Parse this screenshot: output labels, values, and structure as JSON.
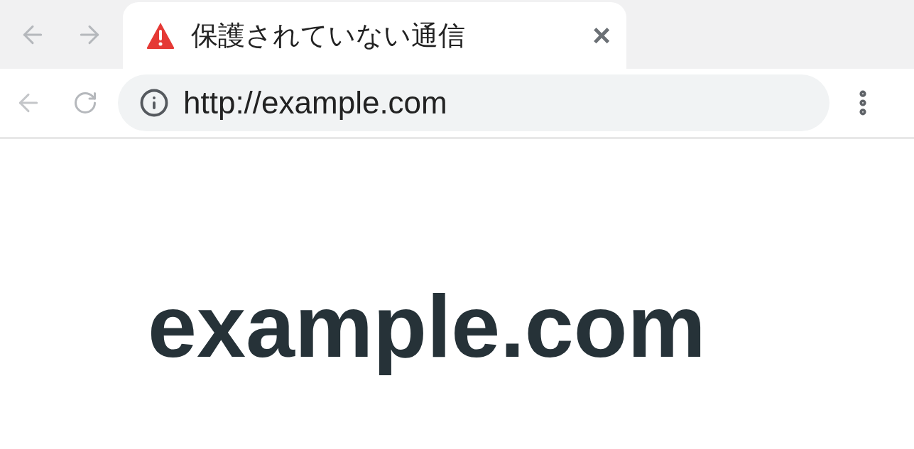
{
  "tab": {
    "title": "保護されていない通信",
    "close": "×"
  },
  "address_bar": {
    "url": "http://example.com"
  },
  "page": {
    "heading": "example.com"
  }
}
